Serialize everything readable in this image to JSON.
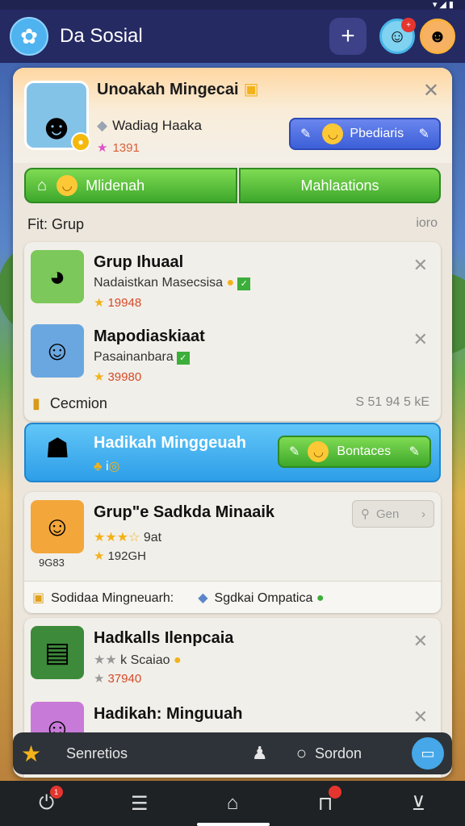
{
  "app": {
    "title": "Da Sosial",
    "add_label": "+",
    "avatar_badge": "+"
  },
  "hero": {
    "title": "Unoakah Mingecai",
    "subtitle": "Wadiag Haaka",
    "score": "1391",
    "button_label": "Pbediaris"
  },
  "tabs": [
    {
      "label": "Mlidenah"
    },
    {
      "label": "Mahlaations"
    }
  ],
  "filter": {
    "label": "Fit: Grup",
    "right": "ioro"
  },
  "group_card": {
    "rows": [
      {
        "title": "Grup Ihuaal",
        "subtitle": "Nadaistkan Masecsisa",
        "score": "19948"
      },
      {
        "title": "Mapodiaskiaat",
        "subtitle": "Pasainanbara",
        "score": "39980"
      }
    ],
    "footer_label": "Cecmion",
    "footer_right": "S 51 94 5 kE"
  },
  "banner": {
    "title": "Hadikah Minggeuah",
    "sub": "i",
    "button_label": "Bontaces"
  },
  "featured": {
    "title": "Grup\"e Sadkda Minaaik",
    "rating_text": "9at",
    "score": "192GH",
    "thumb_caption": "9G83",
    "search_label": "Gen",
    "info_items": [
      {
        "label": "Sodidaa Mingneuarh:"
      },
      {
        "label": "Sgdkai Ompatica"
      }
    ]
  },
  "list": {
    "rows": [
      {
        "title": "Hadkalls Ilenpcaia",
        "subtitle": "k Scaiao",
        "score": "37940"
      },
      {
        "title": "Hadikah: Minguuah"
      }
    ]
  },
  "bottom_sheet": {
    "label1": "Senretios",
    "label2": "Sordon"
  },
  "navbar": {
    "badge1": "1",
    "badge2": ""
  },
  "colors": {
    "appbar": "#252a63",
    "green": "#3ea82c",
    "blue": "#3c5fd8",
    "banner_blue": "#2d9ee8",
    "accent_gold": "#f3b21a"
  }
}
